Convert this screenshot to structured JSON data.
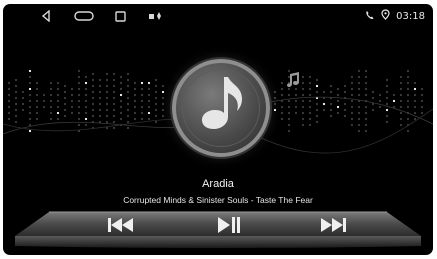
{
  "status_bar": {
    "time": "03:18"
  },
  "track": {
    "title": "Aradia",
    "subtitle": "Corrupted Minds & Sinister Souls - Taste The Fear"
  },
  "icons": {
    "back": "back-icon",
    "home": "home-icon",
    "recents": "recents-icon",
    "notification": "notification-icons",
    "phone": "phone-icon",
    "location": "location-icon",
    "album": "music-note-icon",
    "prev": "skip-previous-icon",
    "play_pause": "play-pause-icon",
    "next": "skip-next-icon"
  },
  "colors": {
    "background": "#000000",
    "accent": "#ffffff",
    "dock": "#3c3c3c"
  }
}
